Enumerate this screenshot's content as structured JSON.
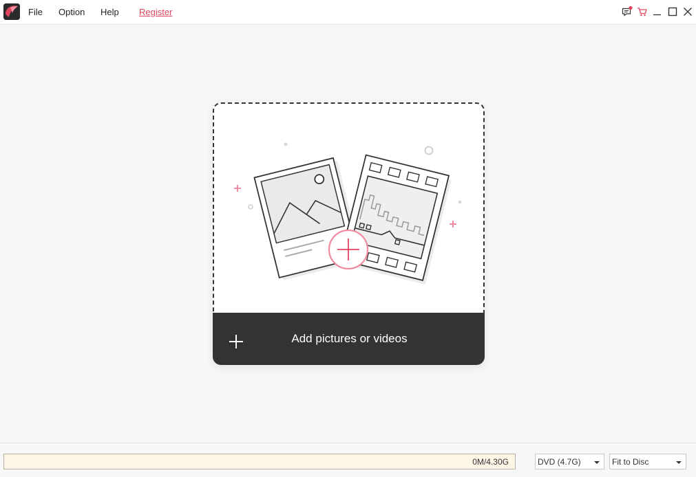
{
  "menu": {
    "file": "File",
    "option": "Option",
    "help": "Help",
    "register": "Register"
  },
  "window_controls": [
    "feedback-icon",
    "cart-icon",
    "minimize-icon",
    "maximize-icon",
    "close-icon"
  ],
  "drop_zone": {
    "add_label": "Add pictures or videos"
  },
  "footer": {
    "capacity": "0M/4.30G",
    "disc_type": "DVD (4.7G)",
    "fit_mode": "Fit to Disc"
  },
  "colors": {
    "accent": "#e0455d",
    "dark_bar": "#333333",
    "capacity_bg": "#fdf6e7"
  }
}
